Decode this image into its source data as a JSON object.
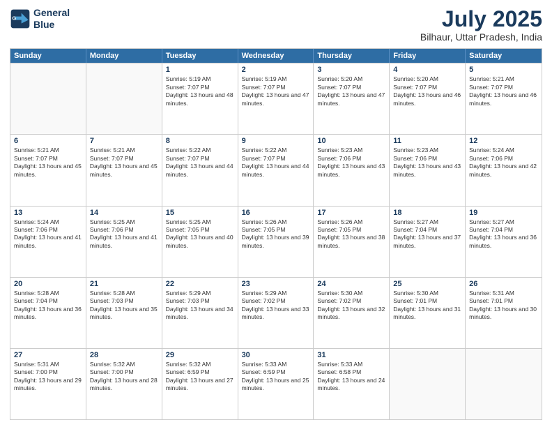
{
  "header": {
    "logo_line1": "General",
    "logo_line2": "Blue",
    "month_year": "July 2025",
    "location": "Bilhaur, Uttar Pradesh, India"
  },
  "days_of_week": [
    "Sunday",
    "Monday",
    "Tuesday",
    "Wednesday",
    "Thursday",
    "Friday",
    "Saturday"
  ],
  "weeks": [
    [
      {
        "day": "",
        "empty": true
      },
      {
        "day": "",
        "empty": true
      },
      {
        "day": "1",
        "sunrise": "5:19 AM",
        "sunset": "7:07 PM",
        "daylight": "13 hours and 48 minutes."
      },
      {
        "day": "2",
        "sunrise": "5:19 AM",
        "sunset": "7:07 PM",
        "daylight": "13 hours and 47 minutes."
      },
      {
        "day": "3",
        "sunrise": "5:20 AM",
        "sunset": "7:07 PM",
        "daylight": "13 hours and 47 minutes."
      },
      {
        "day": "4",
        "sunrise": "5:20 AM",
        "sunset": "7:07 PM",
        "daylight": "13 hours and 46 minutes."
      },
      {
        "day": "5",
        "sunrise": "5:21 AM",
        "sunset": "7:07 PM",
        "daylight": "13 hours and 46 minutes."
      }
    ],
    [
      {
        "day": "6",
        "sunrise": "5:21 AM",
        "sunset": "7:07 PM",
        "daylight": "13 hours and 45 minutes."
      },
      {
        "day": "7",
        "sunrise": "5:21 AM",
        "sunset": "7:07 PM",
        "daylight": "13 hours and 45 minutes."
      },
      {
        "day": "8",
        "sunrise": "5:22 AM",
        "sunset": "7:07 PM",
        "daylight": "13 hours and 44 minutes."
      },
      {
        "day": "9",
        "sunrise": "5:22 AM",
        "sunset": "7:07 PM",
        "daylight": "13 hours and 44 minutes."
      },
      {
        "day": "10",
        "sunrise": "5:23 AM",
        "sunset": "7:06 PM",
        "daylight": "13 hours and 43 minutes."
      },
      {
        "day": "11",
        "sunrise": "5:23 AM",
        "sunset": "7:06 PM",
        "daylight": "13 hours and 43 minutes."
      },
      {
        "day": "12",
        "sunrise": "5:24 AM",
        "sunset": "7:06 PM",
        "daylight": "13 hours and 42 minutes."
      }
    ],
    [
      {
        "day": "13",
        "sunrise": "5:24 AM",
        "sunset": "7:06 PM",
        "daylight": "13 hours and 41 minutes."
      },
      {
        "day": "14",
        "sunrise": "5:25 AM",
        "sunset": "7:06 PM",
        "daylight": "13 hours and 41 minutes."
      },
      {
        "day": "15",
        "sunrise": "5:25 AM",
        "sunset": "7:05 PM",
        "daylight": "13 hours and 40 minutes."
      },
      {
        "day": "16",
        "sunrise": "5:26 AM",
        "sunset": "7:05 PM",
        "daylight": "13 hours and 39 minutes."
      },
      {
        "day": "17",
        "sunrise": "5:26 AM",
        "sunset": "7:05 PM",
        "daylight": "13 hours and 38 minutes."
      },
      {
        "day": "18",
        "sunrise": "5:27 AM",
        "sunset": "7:04 PM",
        "daylight": "13 hours and 37 minutes."
      },
      {
        "day": "19",
        "sunrise": "5:27 AM",
        "sunset": "7:04 PM",
        "daylight": "13 hours and 36 minutes."
      }
    ],
    [
      {
        "day": "20",
        "sunrise": "5:28 AM",
        "sunset": "7:04 PM",
        "daylight": "13 hours and 36 minutes."
      },
      {
        "day": "21",
        "sunrise": "5:28 AM",
        "sunset": "7:03 PM",
        "daylight": "13 hours and 35 minutes."
      },
      {
        "day": "22",
        "sunrise": "5:29 AM",
        "sunset": "7:03 PM",
        "daylight": "13 hours and 34 minutes."
      },
      {
        "day": "23",
        "sunrise": "5:29 AM",
        "sunset": "7:02 PM",
        "daylight": "13 hours and 33 minutes."
      },
      {
        "day": "24",
        "sunrise": "5:30 AM",
        "sunset": "7:02 PM",
        "daylight": "13 hours and 32 minutes."
      },
      {
        "day": "25",
        "sunrise": "5:30 AM",
        "sunset": "7:01 PM",
        "daylight": "13 hours and 31 minutes."
      },
      {
        "day": "26",
        "sunrise": "5:31 AM",
        "sunset": "7:01 PM",
        "daylight": "13 hours and 30 minutes."
      }
    ],
    [
      {
        "day": "27",
        "sunrise": "5:31 AM",
        "sunset": "7:00 PM",
        "daylight": "13 hours and 29 minutes."
      },
      {
        "day": "28",
        "sunrise": "5:32 AM",
        "sunset": "7:00 PM",
        "daylight": "13 hours and 28 minutes."
      },
      {
        "day": "29",
        "sunrise": "5:32 AM",
        "sunset": "6:59 PM",
        "daylight": "13 hours and 27 minutes."
      },
      {
        "day": "30",
        "sunrise": "5:33 AM",
        "sunset": "6:59 PM",
        "daylight": "13 hours and 25 minutes."
      },
      {
        "day": "31",
        "sunrise": "5:33 AM",
        "sunset": "6:58 PM",
        "daylight": "13 hours and 24 minutes."
      },
      {
        "day": "",
        "empty": true
      },
      {
        "day": "",
        "empty": true
      }
    ]
  ]
}
